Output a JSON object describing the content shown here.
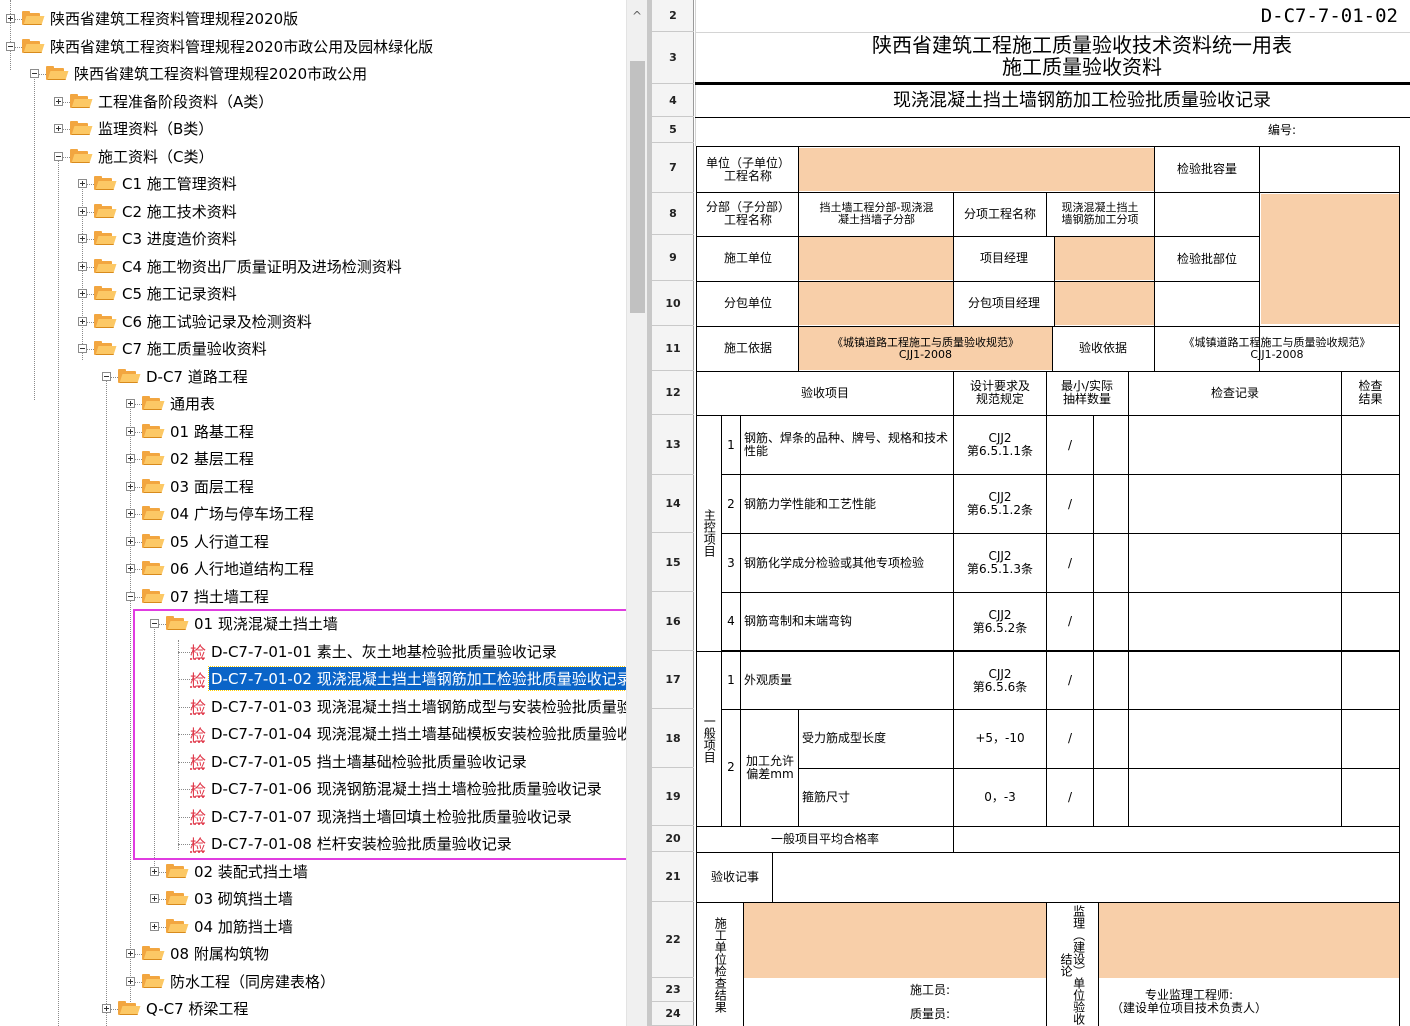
{
  "tree": {
    "items": [
      {
        "label": "陕西省建筑工程资料管理规程2020版",
        "icon": "folder-icon",
        "expander": "plus"
      },
      {
        "label": "陕西省建筑工程资料管理规程2020市政公用及园林绿化版",
        "icon": "folder-icon",
        "expander": "minus"
      },
      {
        "label": "陕西省建筑工程资料管理规程2020市政公用",
        "icon": "folder-icon",
        "expander": "minus"
      },
      {
        "label": "工程准备阶段资料（A类）",
        "icon": "folder-icon",
        "expander": "plus"
      },
      {
        "label": "监理资料（B类）",
        "icon": "folder-icon",
        "expander": "plus"
      },
      {
        "label": "施工资料（C类）",
        "icon": "folder-icon",
        "expander": "minus"
      },
      {
        "label": "C1 施工管理资料",
        "icon": "folder-icon",
        "expander": "plus"
      },
      {
        "label": "C2 施工技术资料",
        "icon": "folder-icon",
        "expander": "plus"
      },
      {
        "label": "C3 进度造价资料",
        "icon": "folder-icon",
        "expander": "plus"
      },
      {
        "label": "C4 施工物资出厂质量证明及进场检测资料",
        "icon": "folder-icon",
        "expander": "plus"
      },
      {
        "label": "C5 施工记录资料",
        "icon": "folder-icon",
        "expander": "plus"
      },
      {
        "label": "C6 施工试验记录及检测资料",
        "icon": "folder-icon",
        "expander": "plus"
      },
      {
        "label": "C7 施工质量验收资料",
        "icon": "folder-icon",
        "expander": "minus"
      },
      {
        "label": "D-C7 道路工程",
        "icon": "folder-icon",
        "expander": "minus"
      },
      {
        "label": "通用表",
        "icon": "folder-icon",
        "expander": "plus"
      },
      {
        "label": "01 路基工程",
        "icon": "folder-icon",
        "expander": "plus"
      },
      {
        "label": "02 基层工程",
        "icon": "folder-icon",
        "expander": "plus"
      },
      {
        "label": "03 面层工程",
        "icon": "folder-icon",
        "expander": "plus"
      },
      {
        "label": "04 广场与停车场工程",
        "icon": "folder-icon",
        "expander": "plus"
      },
      {
        "label": "05 人行道工程",
        "icon": "folder-icon",
        "expander": "plus"
      },
      {
        "label": "06 人行地道结构工程",
        "icon": "folder-icon",
        "expander": "plus"
      },
      {
        "label": "07 挡土墙工程",
        "icon": "folder-icon",
        "expander": "minus"
      },
      {
        "label": "01 现浇混凝土挡土墙",
        "icon": "folder-icon",
        "expander": "minus"
      },
      {
        "label": "D-C7-7-01-01 素土、灰土地基检验批质量验收记录",
        "icon": "check-doc-icon",
        "glyph": "检"
      },
      {
        "label": "D-C7-7-01-02 现浇混凝土挡土墙钢筋加工检验批质量验收记录",
        "icon": "check-doc-icon",
        "glyph": "检",
        "selected": true
      },
      {
        "label": "D-C7-7-01-03 现浇混凝土挡土墙钢筋成型与安装检验批质量验",
        "icon": "check-doc-icon",
        "glyph": "检"
      },
      {
        "label": "D-C7-7-01-04 现浇混凝土挡土墙基础模板安装检验批质量验收",
        "icon": "check-doc-icon",
        "glyph": "检"
      },
      {
        "label": "D-C7-7-01-05 挡土墙基础检验批质量验收记录",
        "icon": "check-doc-icon",
        "glyph": "检"
      },
      {
        "label": "D-C7-7-01-06 现浇钢筋混凝土挡土墙检验批质量验收记录",
        "icon": "check-doc-icon",
        "glyph": "检"
      },
      {
        "label": "D-C7-7-01-07 现浇挡土墙回填土检验批质量验收记录",
        "icon": "check-doc-icon",
        "glyph": "检"
      },
      {
        "label": "D-C7-7-01-08 栏杆安装检验批质量验收记录",
        "icon": "check-doc-icon",
        "glyph": "检"
      },
      {
        "label": "02 装配式挡土墙",
        "icon": "folder-icon",
        "expander": "plus"
      },
      {
        "label": "03 砌筑挡土墙",
        "icon": "folder-icon",
        "expander": "plus"
      },
      {
        "label": "04 加筋挡土墙",
        "icon": "folder-icon",
        "expander": "plus"
      },
      {
        "label": "08 附属构筑物",
        "icon": "folder-icon",
        "expander": "plus"
      },
      {
        "label": "防水工程（同房建表格）",
        "icon": "folder-icon",
        "expander": "plus"
      },
      {
        "label": "Q-C7 桥梁工程",
        "icon": "folder-icon",
        "expander": "plus"
      }
    ],
    "scroll_up_glyph": "^"
  },
  "sheet": {
    "row_numbers": [
      "2",
      "3",
      "4",
      "5",
      "7",
      "8",
      "9",
      "10",
      "11",
      "12",
      "13",
      "14",
      "15",
      "16",
      "17",
      "18",
      "19",
      "20",
      "21",
      "22",
      "23",
      "24"
    ],
    "form_code": "D-C7-7-01-02",
    "title_line1": "陕西省建筑工程施工质量验收技术资料统一用表",
    "title_line2": "施工质量验收资料",
    "record_title": "现浇混凝土挡土墙钢筋加工检验批质量验收记录",
    "number_label": "编号:",
    "unit_project_label": "单位（子单位）\n工程名称",
    "batch_capacity_label": "检验批容量",
    "subdivision_label": "分部（子分部）\n工程名称",
    "subdivision_value": "挡土墙工程分部-现浇混\n凝土挡墙子分部",
    "item_project_label": "分项工程名称",
    "item_project_value": "现浇混凝土挡土\n墙钢筋加工分项",
    "batch_location_label": "检验批部位",
    "construction_unit_label": "施工单位",
    "project_manager_label": "项目经理",
    "subcontract_unit_label": "分包单位",
    "subcontract_manager_label": "分包项目经理",
    "construction_basis_label": "施工依据",
    "construction_basis_value": "《城镇道路工程施工与质量验收规范》\nCJJ1-2008",
    "acceptance_basis_label": "验收依据",
    "acceptance_basis_value": "《城镇道路工程施工与质量验收规范》\nCJJ1-2008",
    "col_item": "验收项目",
    "col_design": "设计要求及\n规范规定",
    "col_sample": "最小/实际\n抽样数量",
    "col_record": "检查记录",
    "col_result": "检查\n结果",
    "main_group_label": "主控项目",
    "general_group_label": "一般项目",
    "main_items": [
      {
        "no": "1",
        "name": "钢筋、焊条的品种、牌号、规格和技术性能",
        "spec": "CJJ2\n第6.5.1.1条",
        "sample": "/"
      },
      {
        "no": "2",
        "name": "钢筋力学性能和工艺性能",
        "spec": "CJJ2\n第6.5.1.2条",
        "sample": "/"
      },
      {
        "no": "3",
        "name": "钢筋化学成分检验或其他专项检验",
        "spec": "CJJ2\n第6.5.1.3条",
        "sample": "/"
      },
      {
        "no": "4",
        "name": "钢筋弯制和末端弯钩",
        "spec": "CJJ2\n第6.5.2条",
        "sample": "/"
      }
    ],
    "general_items": {
      "item1": {
        "no": "1",
        "name": "外观质量",
        "spec": "CJJ2\n第6.5.6条",
        "sample": "/"
      },
      "item2_no": "2",
      "item2_group": "加工允许偏差mm",
      "item2_sub": [
        {
          "name": "受力筋成型长度",
          "spec": "+5，-10",
          "sample": "/"
        },
        {
          "name": "箍筋尺寸",
          "spec": "0，-3",
          "sample": "/"
        }
      ]
    },
    "pass_rate_label": "一般项目平均合格率",
    "acceptance_note_label": "验收记事",
    "construction_check_label": "施工单位检查结果",
    "supervision_label": "监理（建设）单位验收结论",
    "construction_worker_label": "施工员:",
    "quality_worker_label": "质量员:",
    "supervision_engineer_label": "专业监理工程师:\n（建设单位项目技术负责人）"
  },
  "colors": {
    "selection": "#0a64c8",
    "highlight_box": "#e03ce0",
    "folder": "#f2a640",
    "input_fill": "#f8cfa9",
    "check_glyph": "#e0384a"
  }
}
